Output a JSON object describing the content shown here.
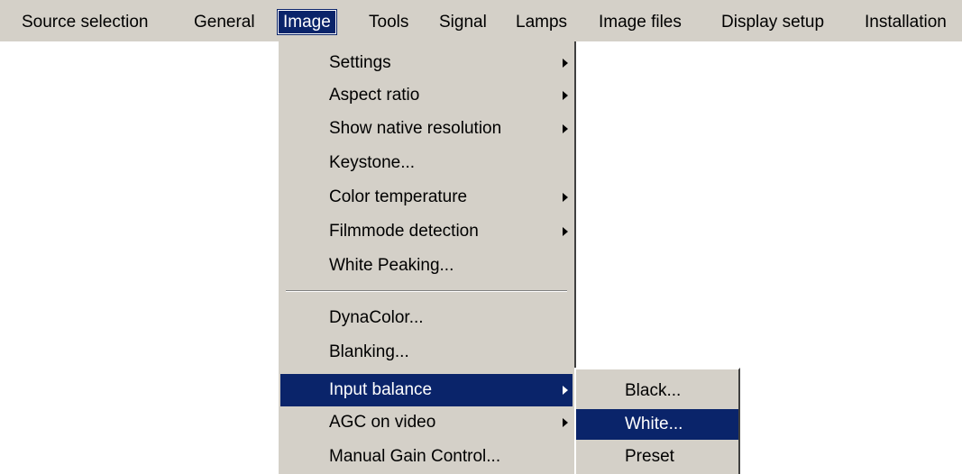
{
  "menubar": {
    "items": [
      {
        "label": "Source selection"
      },
      {
        "label": "General"
      },
      {
        "label": "Image"
      },
      {
        "label": "Tools"
      },
      {
        "label": "Signal"
      },
      {
        "label": "Lamps"
      },
      {
        "label": "Image files"
      },
      {
        "label": "Display setup"
      },
      {
        "label": "Installation"
      }
    ]
  },
  "image_menu": {
    "items": [
      {
        "label": "Settings"
      },
      {
        "label": "Aspect ratio"
      },
      {
        "label": "Show native resolution"
      },
      {
        "label": "Keystone..."
      },
      {
        "label": "Color temperature"
      },
      {
        "label": "Filmmode detection"
      },
      {
        "label": "White Peaking..."
      },
      {
        "label": "DynaColor..."
      },
      {
        "label": "Blanking..."
      },
      {
        "label": "Input balance"
      },
      {
        "label": "AGC on video"
      },
      {
        "label": "Manual Gain Control..."
      }
    ]
  },
  "input_balance_submenu": {
    "items": [
      {
        "label": "Black..."
      },
      {
        "label": "White..."
      },
      {
        "label": "Preset"
      }
    ]
  },
  "colors": {
    "menu_background": "#d4d0c8",
    "highlight": "#0a246a",
    "highlight_text": "#ffffff"
  },
  "icons": {
    "submenu_indicator": "triangle-right-icon"
  }
}
